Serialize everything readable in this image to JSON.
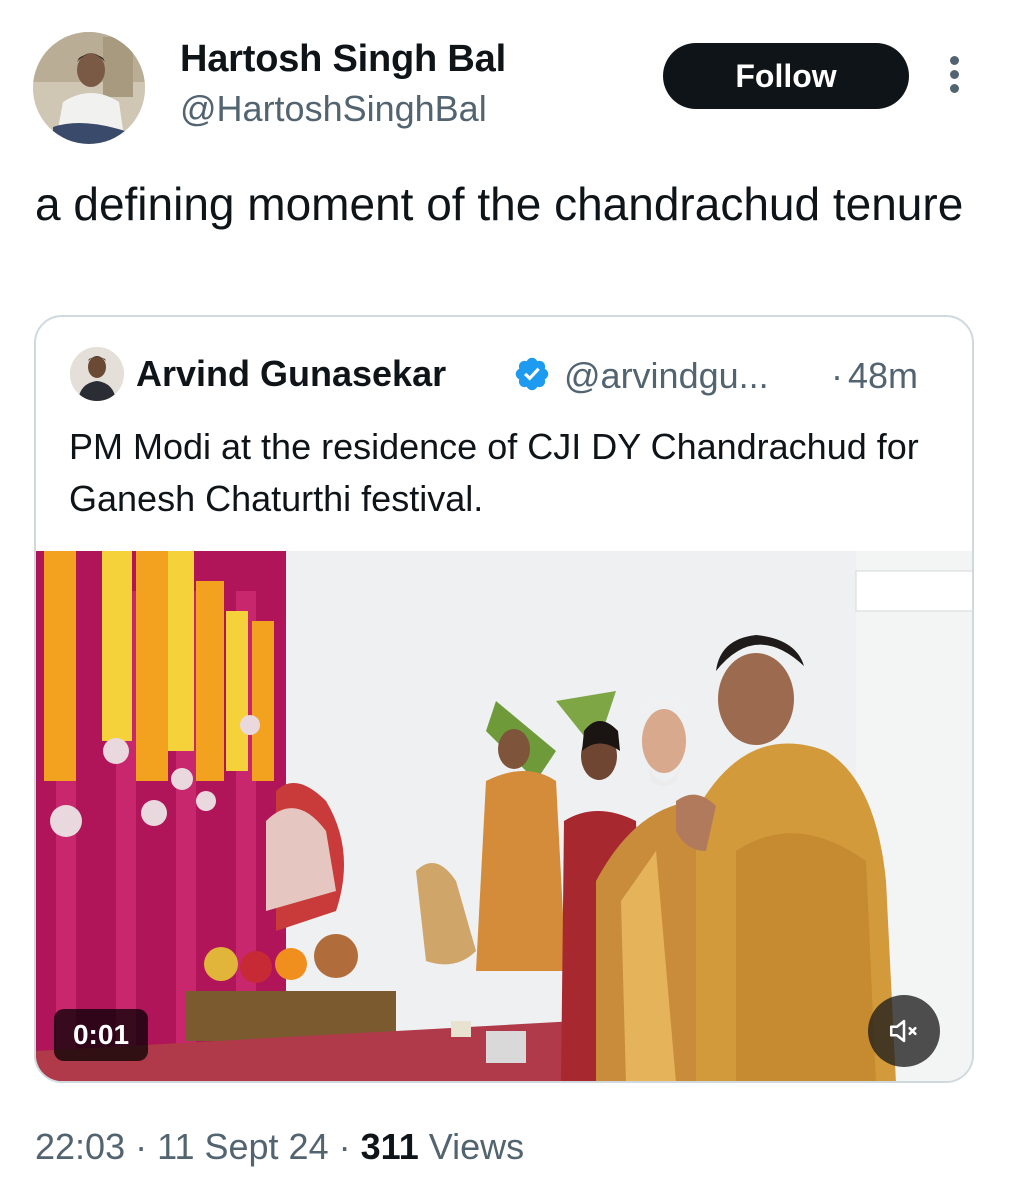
{
  "author": {
    "name": "Hartosh Singh Bal",
    "handle": "@HartoshSinghBal",
    "avatar_icon": "profile-photo"
  },
  "follow_button": {
    "label": "Follow"
  },
  "more_icon": "more-vertical-icon",
  "tweet": {
    "text": "a defining moment of the chandrachud tenure"
  },
  "quoted_tweet": {
    "author_name": "Arvind Gunasekar",
    "verified": true,
    "handle": "@arvindgu...",
    "separator": "·",
    "time_ago": "48m",
    "text": "PM Modi at the residence of CJI DY Chandrachud for Ganesh Chaturthi festival.",
    "video": {
      "duration": "0:01",
      "mute_icon": "volume-muted-icon"
    }
  },
  "meta": {
    "time": "22:03",
    "separator": "·",
    "date": "11 Sept 24",
    "views_count": "311",
    "views_label": "Views"
  },
  "colors": {
    "text_primary": "#0f1419",
    "text_secondary": "#536471",
    "border": "#cfd9de",
    "verified_blue": "#1d9bf0",
    "button_bg": "#0f1419"
  }
}
